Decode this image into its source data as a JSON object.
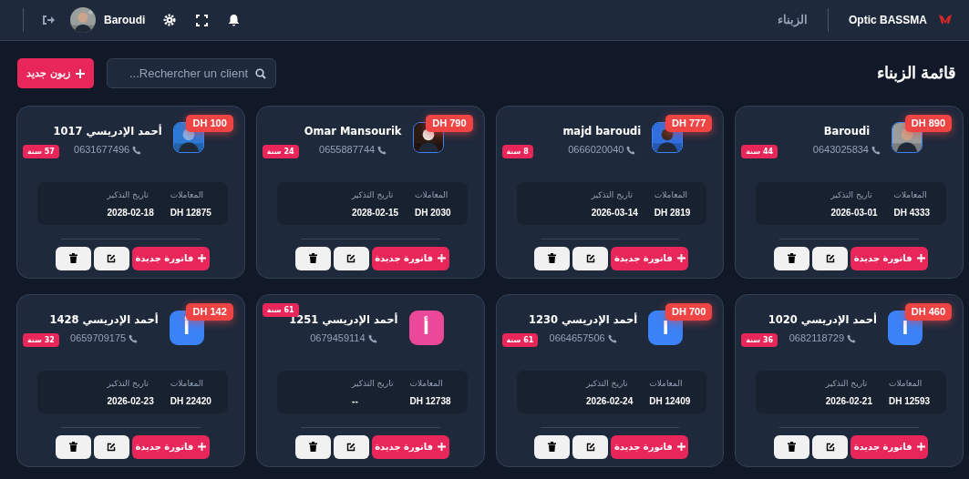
{
  "header": {
    "brand": "Optic BASSMA",
    "section": "الزبناء",
    "user": "Baroudi"
  },
  "toolbar": {
    "title": "قائمة الزبناء",
    "search_placeholder": "Rechercher un client...",
    "add_button": "زبون جديد"
  },
  "clients": [
    {
      "name": "Baroudi",
      "phone": "0643025834",
      "age": "44 سنة",
      "balance": "DH 890",
      "transactions_label": "المعاملات",
      "transactions": "DH 4333",
      "reminder_label": "تاريخ التذكير",
      "reminder": "2026-03-01",
      "invoice_button": "فاتورة جديدة"
    },
    {
      "name": "majd baroudi",
      "phone": "0666020040",
      "age": "8 سنة",
      "balance": "DH 777",
      "transactions_label": "المعاملات",
      "transactions": "DH 2819",
      "reminder_label": "تاريخ التذكير",
      "reminder": "2026-03-14",
      "invoice_button": "فاتورة جديدة"
    },
    {
      "name": "Omar Mansourik",
      "phone": "0655887744",
      "age": "24 سنة",
      "balance": "DH 790",
      "transactions_label": "المعاملات",
      "transactions": "DH 2030",
      "reminder_label": "تاريخ التذكير",
      "reminder": "2028-02-15",
      "invoice_button": "فاتورة جديدة"
    },
    {
      "name": "أحمد الإدريسي 1017",
      "phone": "0631677496",
      "age": "57 سنة",
      "balance": "DH 100",
      "transactions_label": "المعاملات",
      "transactions": "DH 12875",
      "reminder_label": "تاريخ التذكير",
      "reminder": "2028-02-18",
      "invoice_button": "فاتورة جديدة"
    },
    {
      "name": "أحمد الإدريسي 1020",
      "phone": "0682118729",
      "age": "36 سنة",
      "balance": "DH 460",
      "avatar": {
        "kind": "letter",
        "letter": "ا",
        "color": "#3b82f6"
      },
      "transactions_label": "المعاملات",
      "transactions": "DH 12593",
      "reminder_label": "تاريخ التذكير",
      "reminder": "2026-02-21",
      "invoice_button": "فاتورة جديدة"
    },
    {
      "name": "أحمد الإدريسي 1230",
      "phone": "0664657506",
      "age": "61 سنة",
      "balance": "DH 700",
      "avatar": {
        "kind": "letter",
        "letter": "ا",
        "color": "#3b82f6"
      },
      "transactions_label": "المعاملات",
      "transactions": "DH 12409",
      "reminder_label": "تاريخ التذكير",
      "reminder": "2026-02-24",
      "invoice_button": "فاتورة جديدة"
    },
    {
      "name": "أحمد الإدريسي 1251",
      "phone": "0679459114",
      "age": "61 سنة",
      "avatar": {
        "kind": "letter",
        "letter": "أ",
        "color": "#ec4899"
      },
      "transactions_label": "المعاملات",
      "transactions": "DH 12738",
      "reminder_label": "تاريخ التذكير",
      "reminder": "--",
      "invoice_button": "فاتورة جديدة"
    },
    {
      "name": "أحمد الإدريسي 1428",
      "phone": "0659709175",
      "age": "32 سنة",
      "balance": "DH 142",
      "avatar": {
        "kind": "letter",
        "letter": "أ",
        "color": "#3b82f6"
      },
      "transactions_label": "المعاملات",
      "transactions": "DH 22420",
      "reminder_label": "تاريخ التذكير",
      "reminder": "2026-02-23",
      "invoice_button": "فاتورة جديدة"
    }
  ]
}
